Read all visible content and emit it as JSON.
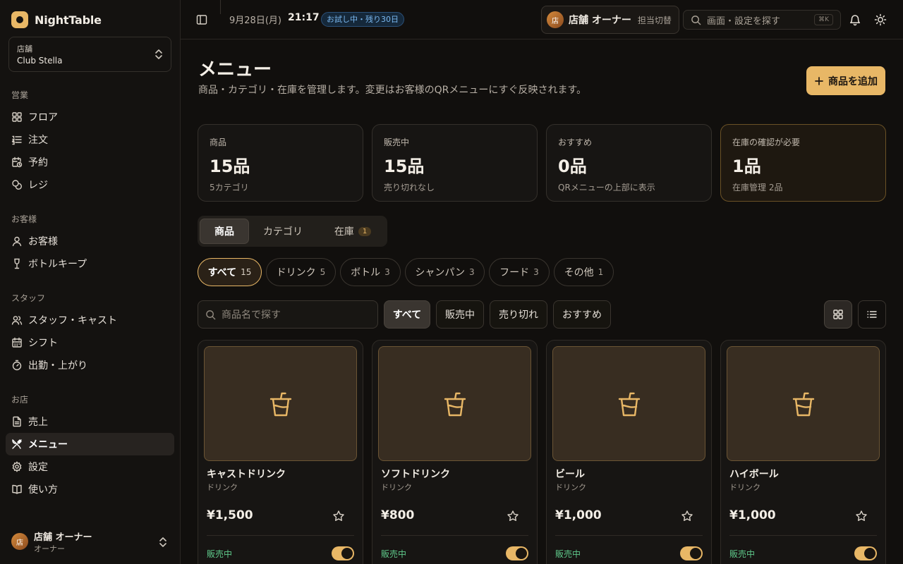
{
  "app": {
    "name": "NightTable"
  },
  "store": {
    "label": "店舗",
    "name": "Club Stella"
  },
  "nav": {
    "sections": [
      {
        "title": "営業"
      },
      {
        "title": "お客様"
      },
      {
        "title": "スタッフ"
      },
      {
        "title": "お店"
      }
    ],
    "items": [
      {
        "label": "フロア",
        "icon": "grid-icon"
      },
      {
        "label": "注文",
        "icon": "list-ordered-icon"
      },
      {
        "label": "予約",
        "icon": "calendar-clock-icon"
      },
      {
        "label": "レジ",
        "icon": "coins-icon"
      },
      {
        "label": "お客様",
        "icon": "user-icon"
      },
      {
        "label": "ボトルキープ",
        "icon": "wine-icon"
      },
      {
        "label": "スタッフ・キャスト",
        "icon": "users-icon"
      },
      {
        "label": "シフト",
        "icon": "calendar-icon"
      },
      {
        "label": "出勤・上がり",
        "icon": "timer-icon"
      },
      {
        "label": "売上",
        "icon": "file-text-icon"
      },
      {
        "label": "メニュー",
        "icon": "utensils-icon",
        "active": true
      },
      {
        "label": "設定",
        "icon": "gear-icon"
      },
      {
        "label": "使い方",
        "icon": "book-icon"
      }
    ]
  },
  "user": {
    "avatar": "店",
    "name": "店舗 オーナー",
    "role": "オーナー"
  },
  "topbar": {
    "date": "9月28日(月)",
    "time": "21:17",
    "trial": "お試し中・残り30日",
    "role_avatar": "店",
    "role_name": "店舗 オーナー",
    "role_switch": "担当切替",
    "search_placeholder": "画面・設定を探す",
    "search_shortcut": "⌘K"
  },
  "page": {
    "title": "メニュー",
    "description": "商品・カテゴリ・在庫を管理します。変更はお客様のQRメニューにすぐ反映されます。",
    "add_button": "商品を追加"
  },
  "stats": [
    {
      "label": "商品",
      "value": "15品",
      "sub": "5カテゴリ"
    },
    {
      "label": "販売中",
      "value": "15品",
      "sub": "売り切れなし"
    },
    {
      "label": "おすすめ",
      "value": "0品",
      "sub": "QRメニューの上部に表示"
    },
    {
      "label": "在庫の確認が必要",
      "value": "1品",
      "sub": "在庫管理 2品"
    }
  ],
  "tabs": [
    {
      "label": "商品"
    },
    {
      "label": "カテゴリ"
    },
    {
      "label": "在庫",
      "badge": "1"
    }
  ],
  "category_chips": [
    {
      "label": "すべて",
      "count": "15"
    },
    {
      "label": "ドリンク",
      "count": "5"
    },
    {
      "label": "ボトル",
      "count": "3"
    },
    {
      "label": "シャンパン",
      "count": "3"
    },
    {
      "label": "フード",
      "count": "3"
    },
    {
      "label": "その他",
      "count": "1"
    }
  ],
  "filter": {
    "search_placeholder": "商品名で探す",
    "buttons": [
      "すべて",
      "販売中",
      "売り切れ",
      "おすすめ"
    ]
  },
  "products": [
    {
      "name": "キャストドリンク",
      "category": "ドリンク",
      "price": "¥1,500",
      "status": "販売中"
    },
    {
      "name": "ソフトドリンク",
      "category": "ドリンク",
      "price": "¥800",
      "status": "販売中"
    },
    {
      "name": "ビール",
      "category": "ドリンク",
      "price": "¥1,000",
      "status": "販売中"
    },
    {
      "name": "ハイボール",
      "category": "ドリンク",
      "price": "¥1,000",
      "status": "販売中"
    }
  ],
  "colors": {
    "accent": "#e8b766",
    "status_ok": "#5fc98a",
    "trial": "#7ab8f0"
  }
}
